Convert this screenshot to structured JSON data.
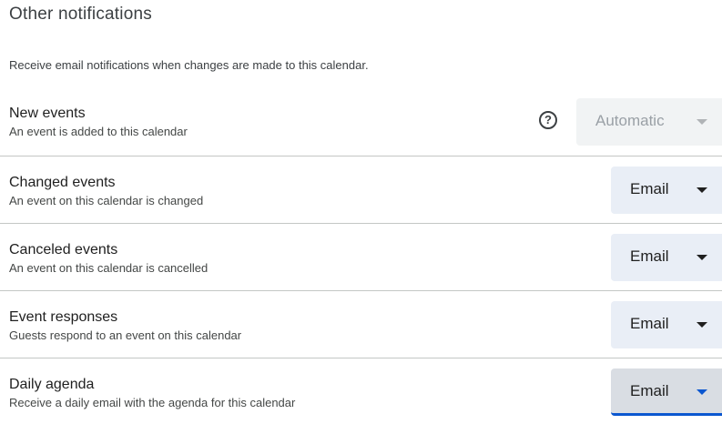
{
  "section": {
    "title": "Other notifications",
    "description": "Receive email notifications when changes are made to this calendar."
  },
  "rows": [
    {
      "title": "New events",
      "subtitle": "An event is added to this calendar",
      "help_icon": "?",
      "select_value": "Automatic",
      "disabled": true
    },
    {
      "title": "Changed events",
      "subtitle": "An event on this calendar is changed",
      "select_value": "Email"
    },
    {
      "title": "Canceled events",
      "subtitle": "An event on this calendar is cancelled",
      "select_value": "Email"
    },
    {
      "title": "Event responses",
      "subtitle": "Guests respond to an event on this calendar",
      "select_value": "Email"
    },
    {
      "title": "Daily agenda",
      "subtitle": "Receive a daily email with the agenda for this calendar",
      "select_value": "Email",
      "focused": true
    }
  ],
  "colors": {
    "select_bg": "#e9eef6",
    "focus_accent": "#0b57d0",
    "divider": "#c4c7c5"
  },
  "icons": {
    "help": "help-circle-icon",
    "dropdown": "dropdown-caret-icon"
  }
}
